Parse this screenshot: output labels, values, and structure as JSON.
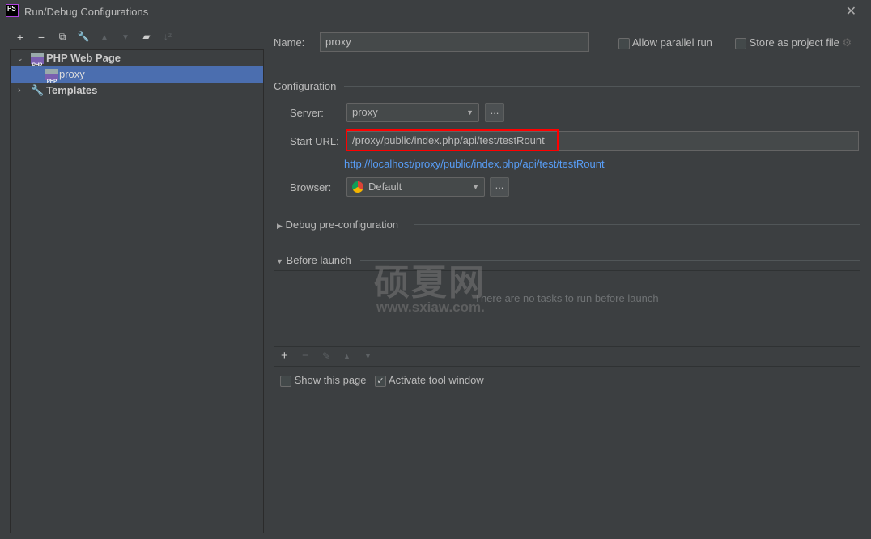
{
  "window": {
    "title": "Run/Debug Configurations",
    "logo": "PS"
  },
  "toolbar": {
    "icons": [
      "plus-icon",
      "minus-icon",
      "copy-icon",
      "wrench-icon",
      "arrow-up-icon",
      "arrow-down-icon",
      "new-folder-icon",
      "sort-icon"
    ]
  },
  "tree": {
    "group": "PHP Web Page",
    "item": "proxy",
    "templates": "Templates",
    "php_badge": "PHP"
  },
  "form": {
    "name_label": "Name:",
    "name_value": "proxy",
    "allow_parallel": "Allow parallel run",
    "allow_parallel_checked": false,
    "store_project": "Store as project file",
    "store_project_checked": false,
    "configuration": "Configuration",
    "server_label": "Server:",
    "server_value": "proxy",
    "ellipsis": "...",
    "start_url_label": "Start URL:",
    "start_url_value": "/proxy/public/index.php/api/test/testRount",
    "resolved_url": "http://localhost/proxy/public/index.php/api/test/testRount",
    "browser_label": "Browser:",
    "browser_value": "Default",
    "debug_preconfig": "Debug pre-configuration",
    "before_launch": "Before launch",
    "no_tasks": "There are no tasks to run before launch",
    "show_page": "Show this page",
    "show_page_checked": false,
    "activate_tool": "Activate tool window",
    "activate_tool_checked": true
  },
  "watermark": {
    "cn": "硕夏网",
    "url": "www.sxiaw.com."
  },
  "colors": {
    "bg": "#3c3f41",
    "selection": "#4b6eaf",
    "link": "#589df6",
    "highlight_box": "#ff0000"
  }
}
